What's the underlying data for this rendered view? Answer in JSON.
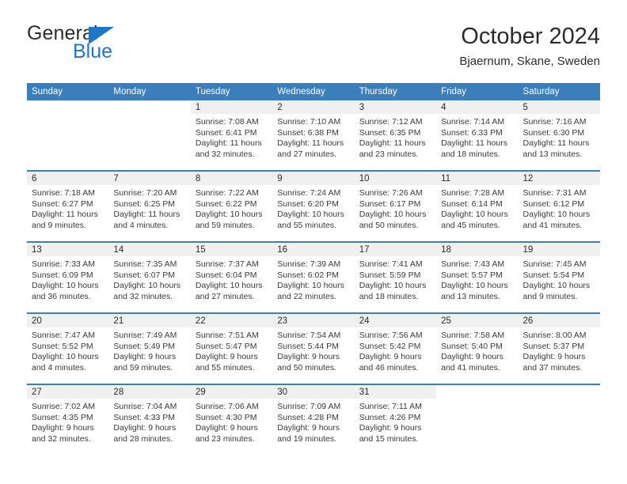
{
  "brand": {
    "name_part1": "General",
    "name_part2": "Blue",
    "triangle_icon": "triangle-icon",
    "color_dark": "#2b2b2b",
    "color_blue": "#1f76c4"
  },
  "header": {
    "title": "October 2024",
    "subtitle": "Bjaernum, Skane, Sweden"
  },
  "theme": {
    "header_blue": "#3b7ebc",
    "daynum_band": "#f0f0f0",
    "text": "#2b2b2b"
  },
  "weekday_headers": [
    "Sunday",
    "Monday",
    "Tuesday",
    "Wednesday",
    "Thursday",
    "Friday",
    "Saturday"
  ],
  "weeks": [
    [
      {
        "day": "",
        "sunrise": "",
        "sunset": "",
        "daylight1": "",
        "daylight2": "",
        "blank": true
      },
      {
        "day": "",
        "sunrise": "",
        "sunset": "",
        "daylight1": "",
        "daylight2": "",
        "blank": true
      },
      {
        "day": "1",
        "sunrise": "Sunrise: 7:08 AM",
        "sunset": "Sunset: 6:41 PM",
        "daylight1": "Daylight: 11 hours",
        "daylight2": "and 32 minutes."
      },
      {
        "day": "2",
        "sunrise": "Sunrise: 7:10 AM",
        "sunset": "Sunset: 6:38 PM",
        "daylight1": "Daylight: 11 hours",
        "daylight2": "and 27 minutes."
      },
      {
        "day": "3",
        "sunrise": "Sunrise: 7:12 AM",
        "sunset": "Sunset: 6:35 PM",
        "daylight1": "Daylight: 11 hours",
        "daylight2": "and 23 minutes."
      },
      {
        "day": "4",
        "sunrise": "Sunrise: 7:14 AM",
        "sunset": "Sunset: 6:33 PM",
        "daylight1": "Daylight: 11 hours",
        "daylight2": "and 18 minutes."
      },
      {
        "day": "5",
        "sunrise": "Sunrise: 7:16 AM",
        "sunset": "Sunset: 6:30 PM",
        "daylight1": "Daylight: 11 hours",
        "daylight2": "and 13 minutes."
      }
    ],
    [
      {
        "day": "6",
        "sunrise": "Sunrise: 7:18 AM",
        "sunset": "Sunset: 6:27 PM",
        "daylight1": "Daylight: 11 hours",
        "daylight2": "and 9 minutes."
      },
      {
        "day": "7",
        "sunrise": "Sunrise: 7:20 AM",
        "sunset": "Sunset: 6:25 PM",
        "daylight1": "Daylight: 11 hours",
        "daylight2": "and 4 minutes."
      },
      {
        "day": "8",
        "sunrise": "Sunrise: 7:22 AM",
        "sunset": "Sunset: 6:22 PM",
        "daylight1": "Daylight: 10 hours",
        "daylight2": "and 59 minutes."
      },
      {
        "day": "9",
        "sunrise": "Sunrise: 7:24 AM",
        "sunset": "Sunset: 6:20 PM",
        "daylight1": "Daylight: 10 hours",
        "daylight2": "and 55 minutes."
      },
      {
        "day": "10",
        "sunrise": "Sunrise: 7:26 AM",
        "sunset": "Sunset: 6:17 PM",
        "daylight1": "Daylight: 10 hours",
        "daylight2": "and 50 minutes."
      },
      {
        "day": "11",
        "sunrise": "Sunrise: 7:28 AM",
        "sunset": "Sunset: 6:14 PM",
        "daylight1": "Daylight: 10 hours",
        "daylight2": "and 45 minutes."
      },
      {
        "day": "12",
        "sunrise": "Sunrise: 7:31 AM",
        "sunset": "Sunset: 6:12 PM",
        "daylight1": "Daylight: 10 hours",
        "daylight2": "and 41 minutes."
      }
    ],
    [
      {
        "day": "13",
        "sunrise": "Sunrise: 7:33 AM",
        "sunset": "Sunset: 6:09 PM",
        "daylight1": "Daylight: 10 hours",
        "daylight2": "and 36 minutes."
      },
      {
        "day": "14",
        "sunrise": "Sunrise: 7:35 AM",
        "sunset": "Sunset: 6:07 PM",
        "daylight1": "Daylight: 10 hours",
        "daylight2": "and 32 minutes."
      },
      {
        "day": "15",
        "sunrise": "Sunrise: 7:37 AM",
        "sunset": "Sunset: 6:04 PM",
        "daylight1": "Daylight: 10 hours",
        "daylight2": "and 27 minutes."
      },
      {
        "day": "16",
        "sunrise": "Sunrise: 7:39 AM",
        "sunset": "Sunset: 6:02 PM",
        "daylight1": "Daylight: 10 hours",
        "daylight2": "and 22 minutes."
      },
      {
        "day": "17",
        "sunrise": "Sunrise: 7:41 AM",
        "sunset": "Sunset: 5:59 PM",
        "daylight1": "Daylight: 10 hours",
        "daylight2": "and 18 minutes."
      },
      {
        "day": "18",
        "sunrise": "Sunrise: 7:43 AM",
        "sunset": "Sunset: 5:57 PM",
        "daylight1": "Daylight: 10 hours",
        "daylight2": "and 13 minutes."
      },
      {
        "day": "19",
        "sunrise": "Sunrise: 7:45 AM",
        "sunset": "Sunset: 5:54 PM",
        "daylight1": "Daylight: 10 hours",
        "daylight2": "and 9 minutes."
      }
    ],
    [
      {
        "day": "20",
        "sunrise": "Sunrise: 7:47 AM",
        "sunset": "Sunset: 5:52 PM",
        "daylight1": "Daylight: 10 hours",
        "daylight2": "and 4 minutes."
      },
      {
        "day": "21",
        "sunrise": "Sunrise: 7:49 AM",
        "sunset": "Sunset: 5:49 PM",
        "daylight1": "Daylight: 9 hours",
        "daylight2": "and 59 minutes."
      },
      {
        "day": "22",
        "sunrise": "Sunrise: 7:51 AM",
        "sunset": "Sunset: 5:47 PM",
        "daylight1": "Daylight: 9 hours",
        "daylight2": "and 55 minutes."
      },
      {
        "day": "23",
        "sunrise": "Sunrise: 7:54 AM",
        "sunset": "Sunset: 5:44 PM",
        "daylight1": "Daylight: 9 hours",
        "daylight2": "and 50 minutes."
      },
      {
        "day": "24",
        "sunrise": "Sunrise: 7:56 AM",
        "sunset": "Sunset: 5:42 PM",
        "daylight1": "Daylight: 9 hours",
        "daylight2": "and 46 minutes."
      },
      {
        "day": "25",
        "sunrise": "Sunrise: 7:58 AM",
        "sunset": "Sunset: 5:40 PM",
        "daylight1": "Daylight: 9 hours",
        "daylight2": "and 41 minutes."
      },
      {
        "day": "26",
        "sunrise": "Sunrise: 8:00 AM",
        "sunset": "Sunset: 5:37 PM",
        "daylight1": "Daylight: 9 hours",
        "daylight2": "and 37 minutes."
      }
    ],
    [
      {
        "day": "27",
        "sunrise": "Sunrise: 7:02 AM",
        "sunset": "Sunset: 4:35 PM",
        "daylight1": "Daylight: 9 hours",
        "daylight2": "and 32 minutes."
      },
      {
        "day": "28",
        "sunrise": "Sunrise: 7:04 AM",
        "sunset": "Sunset: 4:33 PM",
        "daylight1": "Daylight: 9 hours",
        "daylight2": "and 28 minutes."
      },
      {
        "day": "29",
        "sunrise": "Sunrise: 7:06 AM",
        "sunset": "Sunset: 4:30 PM",
        "daylight1": "Daylight: 9 hours",
        "daylight2": "and 23 minutes."
      },
      {
        "day": "30",
        "sunrise": "Sunrise: 7:09 AM",
        "sunset": "Sunset: 4:28 PM",
        "daylight1": "Daylight: 9 hours",
        "daylight2": "and 19 minutes."
      },
      {
        "day": "31",
        "sunrise": "Sunrise: 7:11 AM",
        "sunset": "Sunset: 4:26 PM",
        "daylight1": "Daylight: 9 hours",
        "daylight2": "and 15 minutes."
      },
      {
        "day": "",
        "sunrise": "",
        "sunset": "",
        "daylight1": "",
        "daylight2": "",
        "blank": true
      },
      {
        "day": "",
        "sunrise": "",
        "sunset": "",
        "daylight1": "",
        "daylight2": "",
        "blank": true
      }
    ]
  ]
}
